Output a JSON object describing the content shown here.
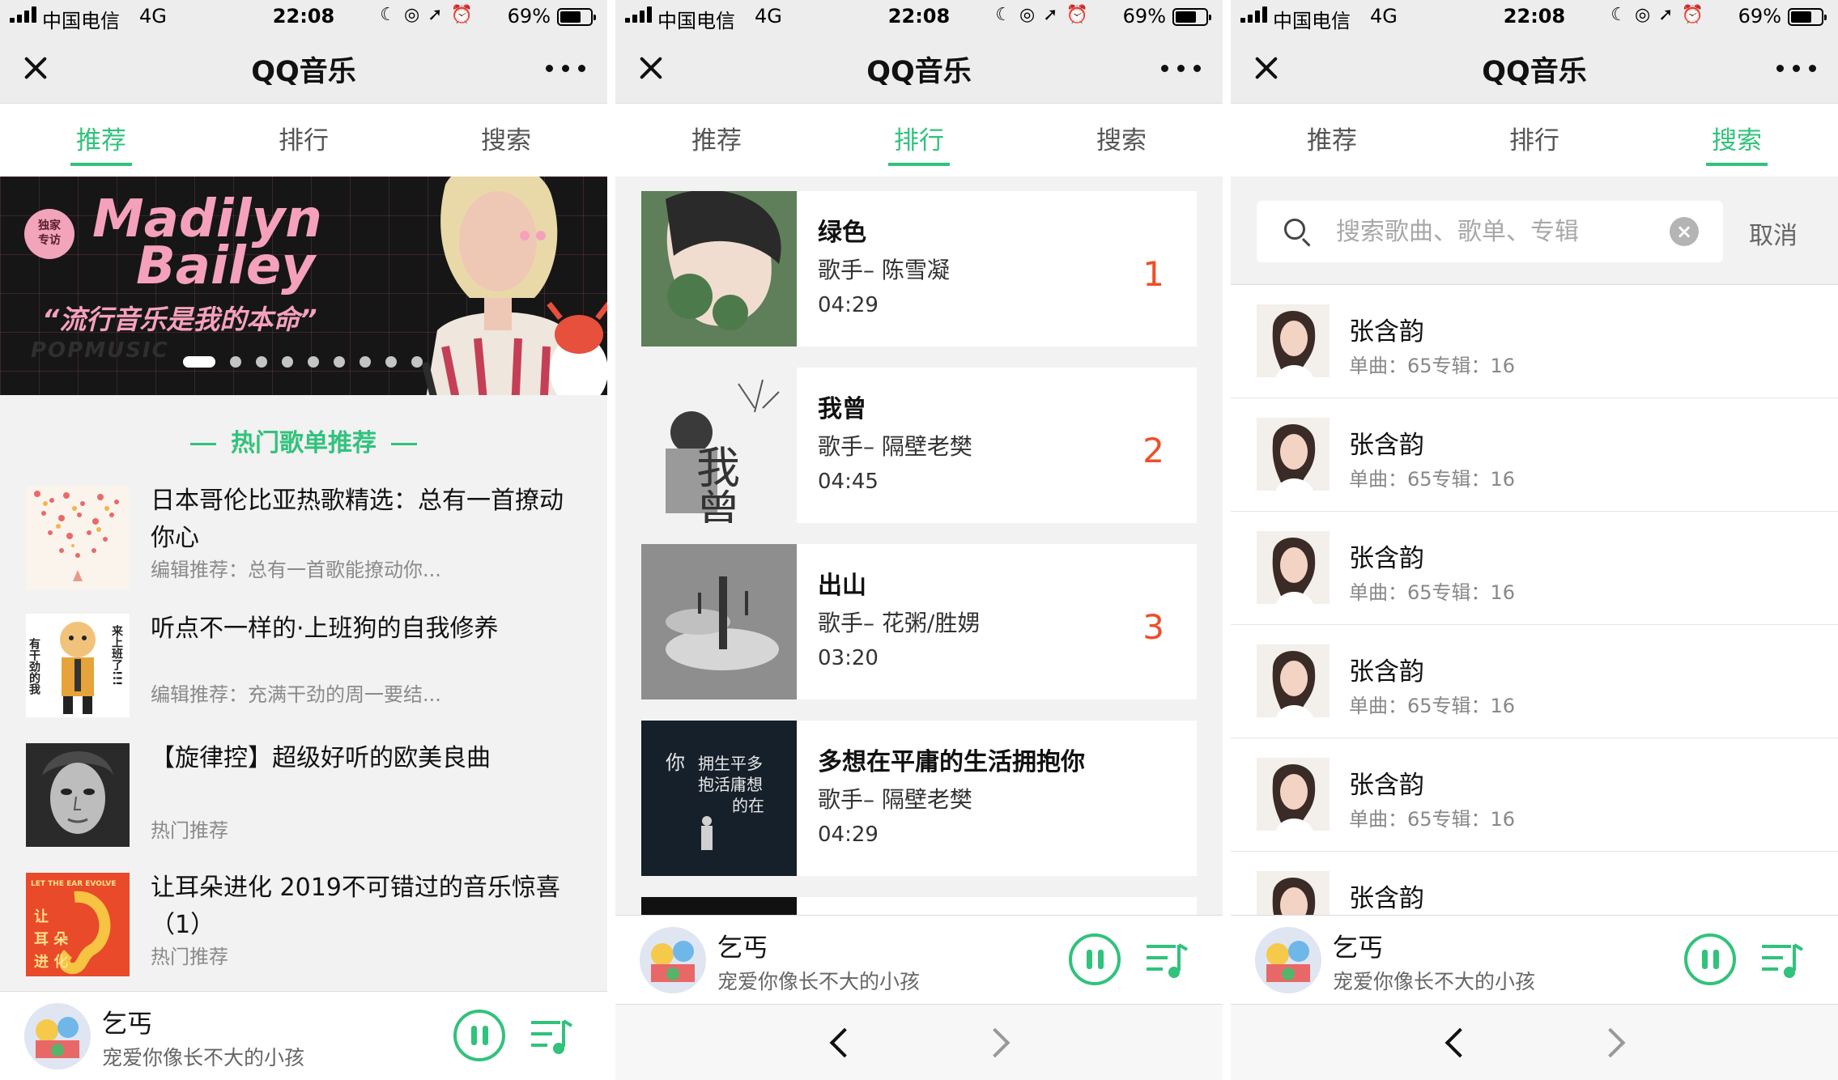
{
  "status_bar": {
    "carrier": "中国电信",
    "network": "4G",
    "time": "22:08",
    "battery_percent": "69%",
    "battery_level": 0.69
  },
  "app": {
    "title": "QQ音乐",
    "tabs": [
      "推荐",
      "排行",
      "搜索"
    ]
  },
  "recommend": {
    "banner": {
      "badge_line1": "独家",
      "badge_line2": "专访",
      "name_line1": "Madilyn",
      "name_line2": "Bailey",
      "slogan": "“流行音乐是我的本命”",
      "footer": "POPMUSIC",
      "slide_count": 9,
      "active_slide": 1
    },
    "section_title": "热门歌单推荐",
    "playlists": [
      {
        "title": "日本哥伦比亚热歌精选：总有一首撩动你心",
        "subtitle": "编辑推荐：总有一首歌能撩动你..."
      },
      {
        "title": "听点不一样的·上班狗的自我修养",
        "subtitle": "编辑推荐：充满干劲的周一要结..."
      },
      {
        "title": "【旋律控】超级好听的欧美良曲",
        "subtitle": "热门推荐"
      },
      {
        "title": "让耳朵进化  2019不可错过的音乐惊喜（1）",
        "subtitle": "热门推荐"
      }
    ],
    "cover_text": {
      "dog_left": "有干劲的我",
      "dog_right": "来上班了!!!",
      "ear_top": "LET THE EAR EVOLVE",
      "ear_chars": "让耳朵进化"
    }
  },
  "ranking": {
    "singer_prefix": "歌手– ",
    "songs": [
      {
        "name": "绿色",
        "singer": "陈雪凝",
        "duration": "04:29",
        "rank": "1"
      },
      {
        "name": "我曾",
        "singer": "隔壁老樊",
        "duration": "04:45",
        "rank": "2"
      },
      {
        "name": "出山",
        "singer": "花粥/胜娚",
        "duration": "03:20",
        "rank": "3"
      },
      {
        "name": "多想在平庸的生活拥抱你",
        "singer": "隔壁老樊",
        "duration": "04:29",
        "rank": ""
      }
    ],
    "cover_text": {
      "song2": "我曾",
      "song4": "你拥抱在平庸的生活多想"
    }
  },
  "search": {
    "placeholder": "搜索歌曲、歌单、专辑",
    "value": "",
    "cancel_label": "取消",
    "results": [
      {
        "name": "张含韵",
        "meta": "单曲：65专辑：16"
      },
      {
        "name": "张含韵",
        "meta": "单曲：65专辑：16"
      },
      {
        "name": "张含韵",
        "meta": "单曲：65专辑：16"
      },
      {
        "name": "张含韵",
        "meta": "单曲：65专辑：16"
      },
      {
        "name": "张含韵",
        "meta": "单曲：65专辑：16"
      },
      {
        "name": "张含韵",
        "meta": ""
      }
    ]
  },
  "player": {
    "song": "乞丐",
    "artist": "宠爱你像长不大的小孩"
  },
  "icons": {
    "close": "close-icon",
    "more": "more-icon",
    "pause": "pause-icon",
    "playlist": "playlist-icon",
    "search": "search-icon",
    "clear": "clear-icon",
    "back": "chevron-left-icon",
    "forward": "chevron-right-icon"
  },
  "colors": {
    "accent": "#31c27c",
    "rank_number": "#ef4e2a",
    "banner_pink": "#f5a1bc",
    "background_grey": "#f2f2f2"
  }
}
